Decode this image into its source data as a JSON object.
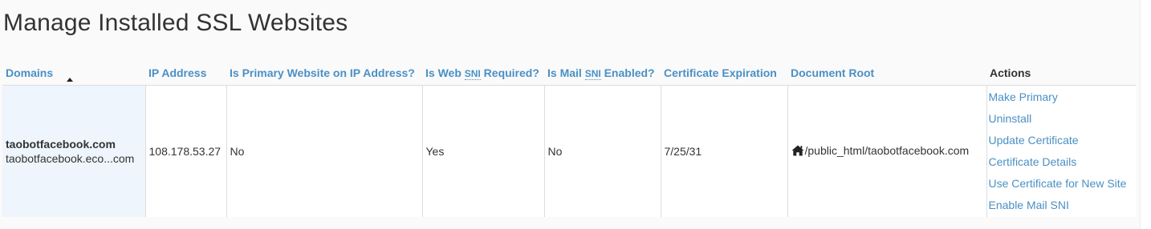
{
  "page": {
    "title": "Manage Installed SSL Websites"
  },
  "table": {
    "headers": {
      "domains": "Domains",
      "ip_address": "IP Address",
      "is_primary": "Is Primary Website on IP Address?",
      "web_sni_prefix": "Is Web",
      "web_sni_abbr": "SNI",
      "web_sni_suffix": "Required?",
      "mail_sni_prefix": "Is Mail",
      "mail_sni_abbr": "SNI",
      "mail_sni_suffix": "Enabled?",
      "cert_expiration": "Certificate Expiration",
      "document_root": "Document Root",
      "actions": "Actions"
    },
    "sort": {
      "column": "Domains",
      "direction": "ascending"
    },
    "rows": [
      {
        "domain": "taobotfacebook.com",
        "domain_alias": "taobotfacebook.eco...com",
        "ip_address": "108.178.53.27",
        "is_primary": "No",
        "web_sni_required": "Yes",
        "mail_sni_enabled": "No",
        "cert_expiration": "7/25/31",
        "document_root_icon": "home-icon",
        "document_root": "/public_html/taobotfacebook.com",
        "actions": [
          "Make Primary",
          "Uninstall",
          "Update Certificate",
          "Certificate Details",
          "Use Certificate for New Site",
          "Enable Mail SNI"
        ]
      }
    ]
  },
  "colors": {
    "link": "#4a90c4",
    "domain_cell_bg": "#eef5fc",
    "text": "#333333"
  }
}
